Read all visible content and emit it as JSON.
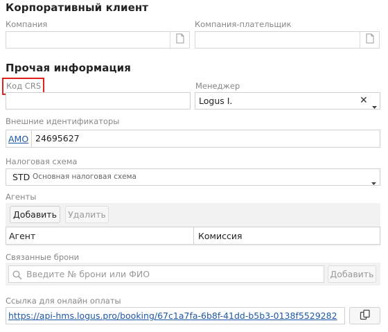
{
  "corporate": {
    "title": "Корпоративный клиент",
    "company_label": "Компания",
    "payer_label": "Компания-плательщик",
    "company_value": "",
    "payer_value": ""
  },
  "other": {
    "title": "Прочая информация",
    "crs_label": "Код CRS",
    "crs_value": "",
    "manager_label": "Менеджер",
    "manager_value": "Logus I.",
    "external_ids_label": "Внешние идентификаторы",
    "external_id_source": "AMO",
    "external_id_value": "24695627",
    "tax_label": "Налоговая схема",
    "tax_code": "STD",
    "tax_name": "Основная налоговая схема",
    "agents_label": "Агенты",
    "add_button": "Добавить",
    "delete_button": "Удалить",
    "agents_table": {
      "columns": [
        "Агент",
        "Комиссия"
      ],
      "rows": []
    },
    "linked_label": "Связанные брони",
    "linked_placeholder": "Введите № брони или ФИО",
    "linked_add_button": "Добавить",
    "payment_link_label": "Ссылка для онлайн оплаты",
    "payment_link": "https://api-hms.logus.pro/booking/67c1a7fa-6b8f-41dd-b5b3-0138f5529282"
  },
  "highlight_color": "#e0201b"
}
